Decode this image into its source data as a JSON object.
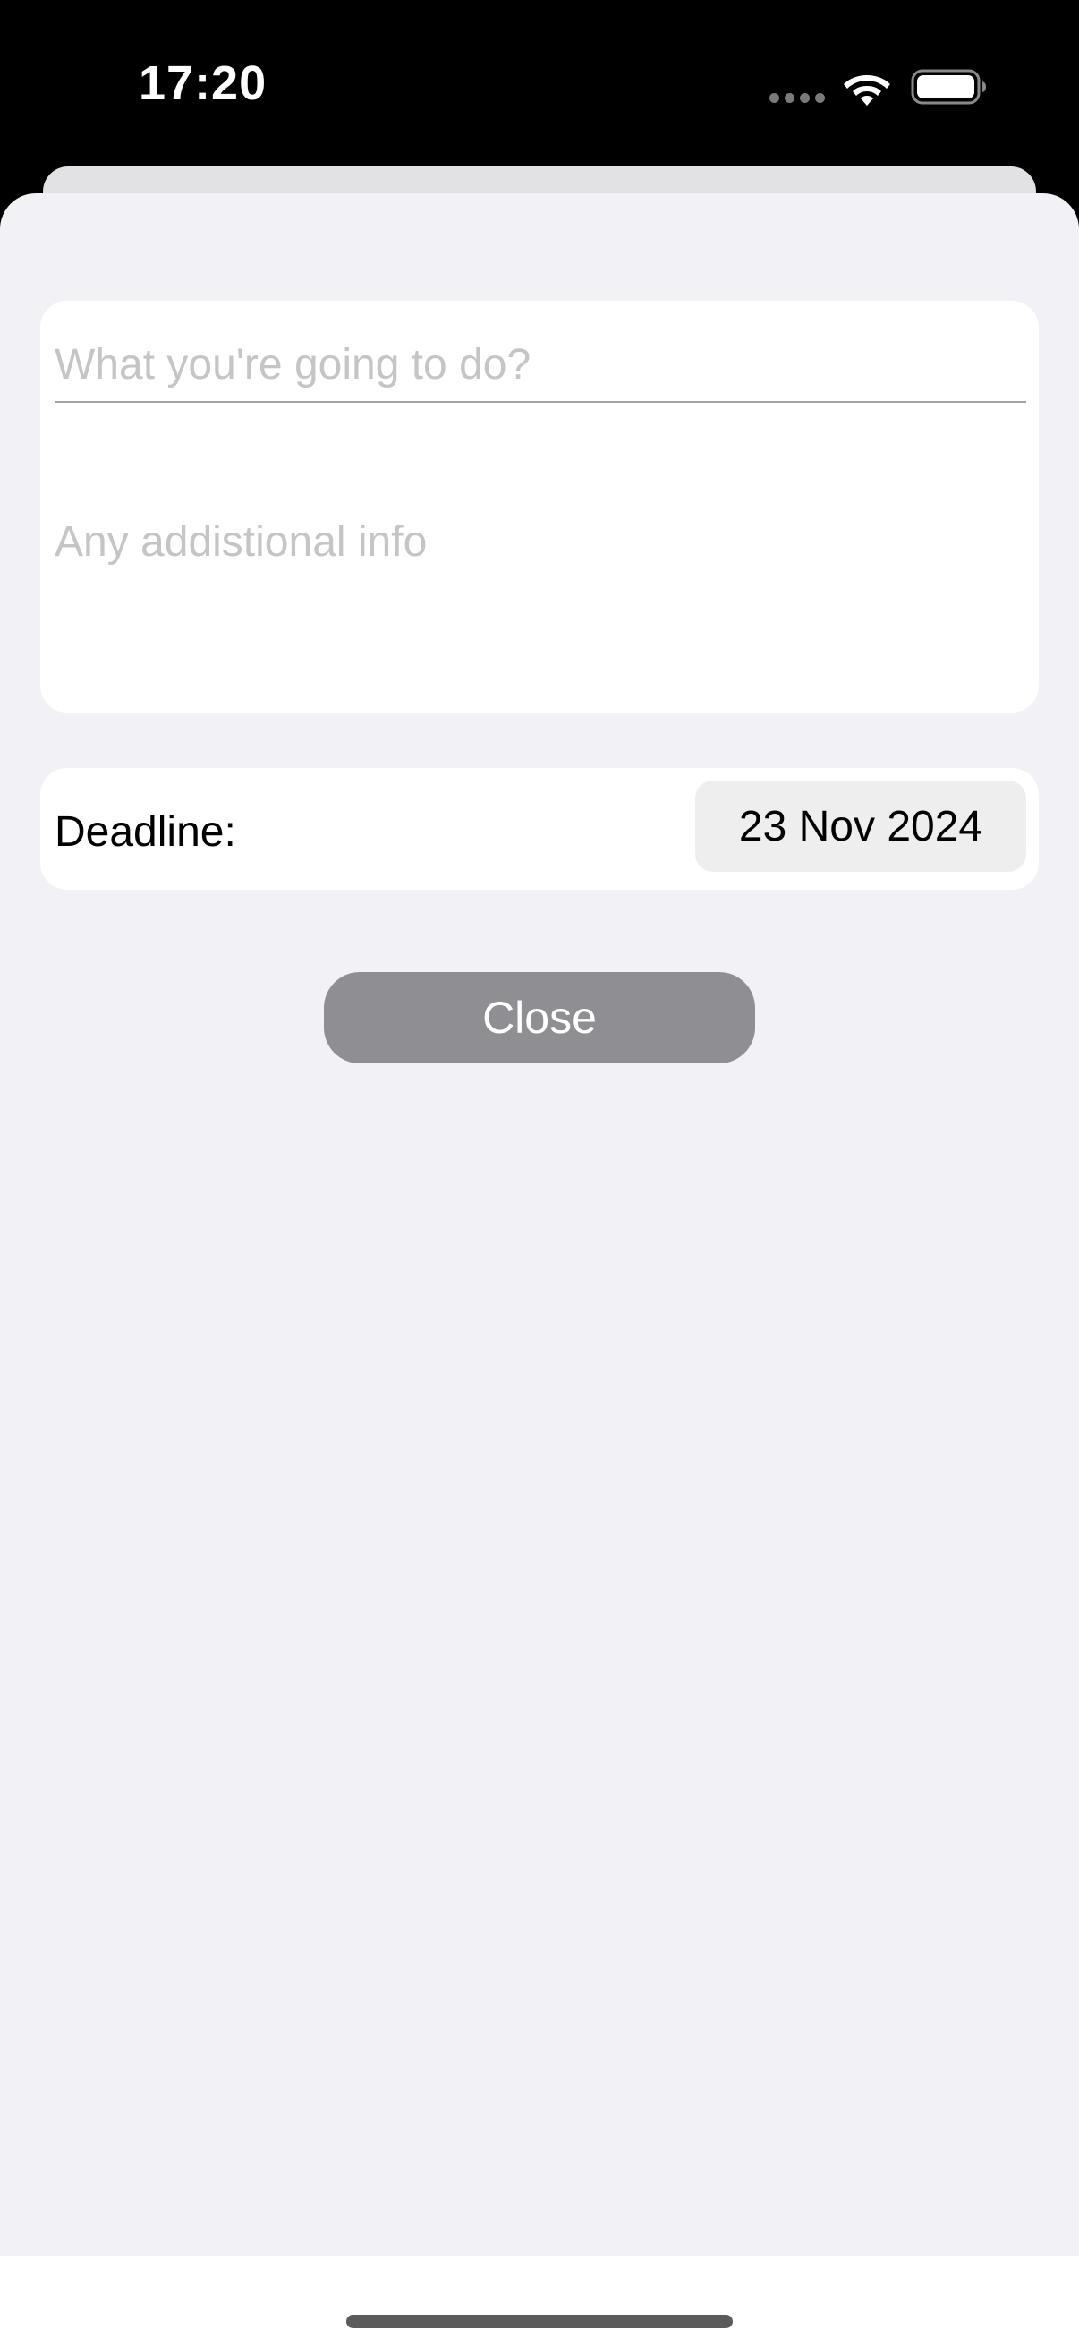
{
  "status_bar": {
    "time": "17:20",
    "icons": [
      "signal-dots-icon",
      "wifi-icon",
      "battery-icon"
    ]
  },
  "form": {
    "title_placeholder": "What you're going to do?",
    "title_value": "",
    "info_placeholder": "Any addistional info",
    "info_value": "",
    "deadline_label": "Deadline:",
    "deadline_value": "23 Nov 2024"
  },
  "actions": {
    "close_label": "Close"
  },
  "colors": {
    "sheet_background": "#f2f1f6",
    "group_background": "#ffffff",
    "close_button": "#8e8e93",
    "placeholder_text": "#c5c5c8",
    "date_chip": "#eeeeef"
  }
}
